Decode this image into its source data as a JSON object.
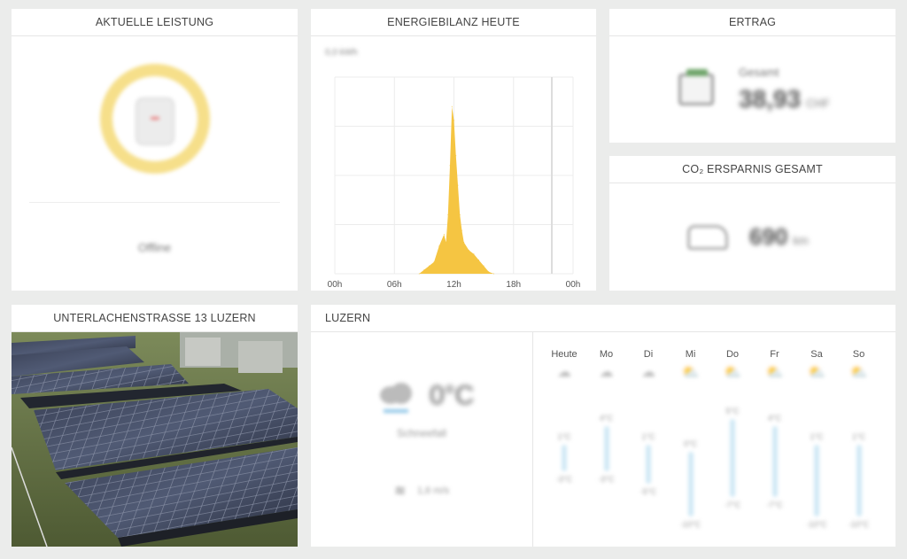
{
  "cards": {
    "leistung": {
      "title": "AKTUELLE LEISTUNG",
      "status": "Offline"
    },
    "energie": {
      "title": "ENERGIEBILANZ HEUTE",
      "unit": "0,0 kWh",
      "xticks": [
        "00h",
        "06h",
        "12h",
        "18h",
        "00h"
      ]
    },
    "ertrag": {
      "title": "ERTRAG",
      "label": "Gesamt",
      "value": "38,93",
      "unit": "CHF"
    },
    "co2": {
      "title": "CO₂ ERSPARNIS GESAMT",
      "value": "690",
      "unit": "km"
    },
    "photo": {
      "title": "UNTERLACHENSTRASSE 13 LUZERN"
    },
    "wetter": {
      "title": "LUZERN",
      "temp": "0°C",
      "condition": "Schneefall",
      "wind": "1,6 m/s",
      "days": [
        {
          "name": "Heute",
          "icon": "cloud-icon",
          "max": "1°C",
          "min": "-3°C",
          "hi": 1,
          "lo": -3
        },
        {
          "name": "Mo",
          "icon": "cloud-icon",
          "max": "4°C",
          "min": "-3°C",
          "hi": 4,
          "lo": -3
        },
        {
          "name": "Di",
          "icon": "cloud-icon",
          "max": "1°C",
          "min": "-5°C",
          "hi": 1,
          "lo": -5
        },
        {
          "name": "Mi",
          "icon": "sun-cloud-icon",
          "max": "0°C",
          "min": "-10°C",
          "hi": 0,
          "lo": -10
        },
        {
          "name": "Do",
          "icon": "sun-cloud-icon",
          "max": "5°C",
          "min": "-7°C",
          "hi": 5,
          "lo": -7
        },
        {
          "name": "Fr",
          "icon": "sun-cloud-icon",
          "max": "4°C",
          "min": "-7°C",
          "hi": 4,
          "lo": -7
        },
        {
          "name": "Sa",
          "icon": "sun-cloud-icon",
          "max": "1°C",
          "min": "-10°C",
          "hi": 1,
          "lo": -10
        },
        {
          "name": "So",
          "icon": "sun-cloud-icon",
          "max": "1°C",
          "min": "-10°C",
          "hi": 1,
          "lo": -10
        }
      ]
    }
  },
  "colors": {
    "accent": "#f5c542",
    "ring": "#f6df8a",
    "bar": "#cfe8f5"
  },
  "chart_data": {
    "type": "area",
    "title": "",
    "xlabel": "",
    "ylabel": "",
    "x_ticks": [
      "00h",
      "06h",
      "12h",
      "18h",
      "00h"
    ],
    "x": [
      8.5,
      9,
      9.5,
      10,
      10.5,
      11,
      11.2,
      11.4,
      11.6,
      11.8,
      12,
      12.2,
      12.4,
      12.6,
      12.8,
      13,
      13.5,
      14,
      14.5,
      15,
      15.5,
      16
    ],
    "y": [
      0,
      0.02,
      0.04,
      0.06,
      0.14,
      0.2,
      0.16,
      0.3,
      0.55,
      0.85,
      0.78,
      0.6,
      0.45,
      0.3,
      0.22,
      0.16,
      0.12,
      0.1,
      0.07,
      0.04,
      0.01,
      0
    ],
    "xlim": [
      0,
      24
    ],
    "ylim": [
      0,
      1
    ]
  }
}
